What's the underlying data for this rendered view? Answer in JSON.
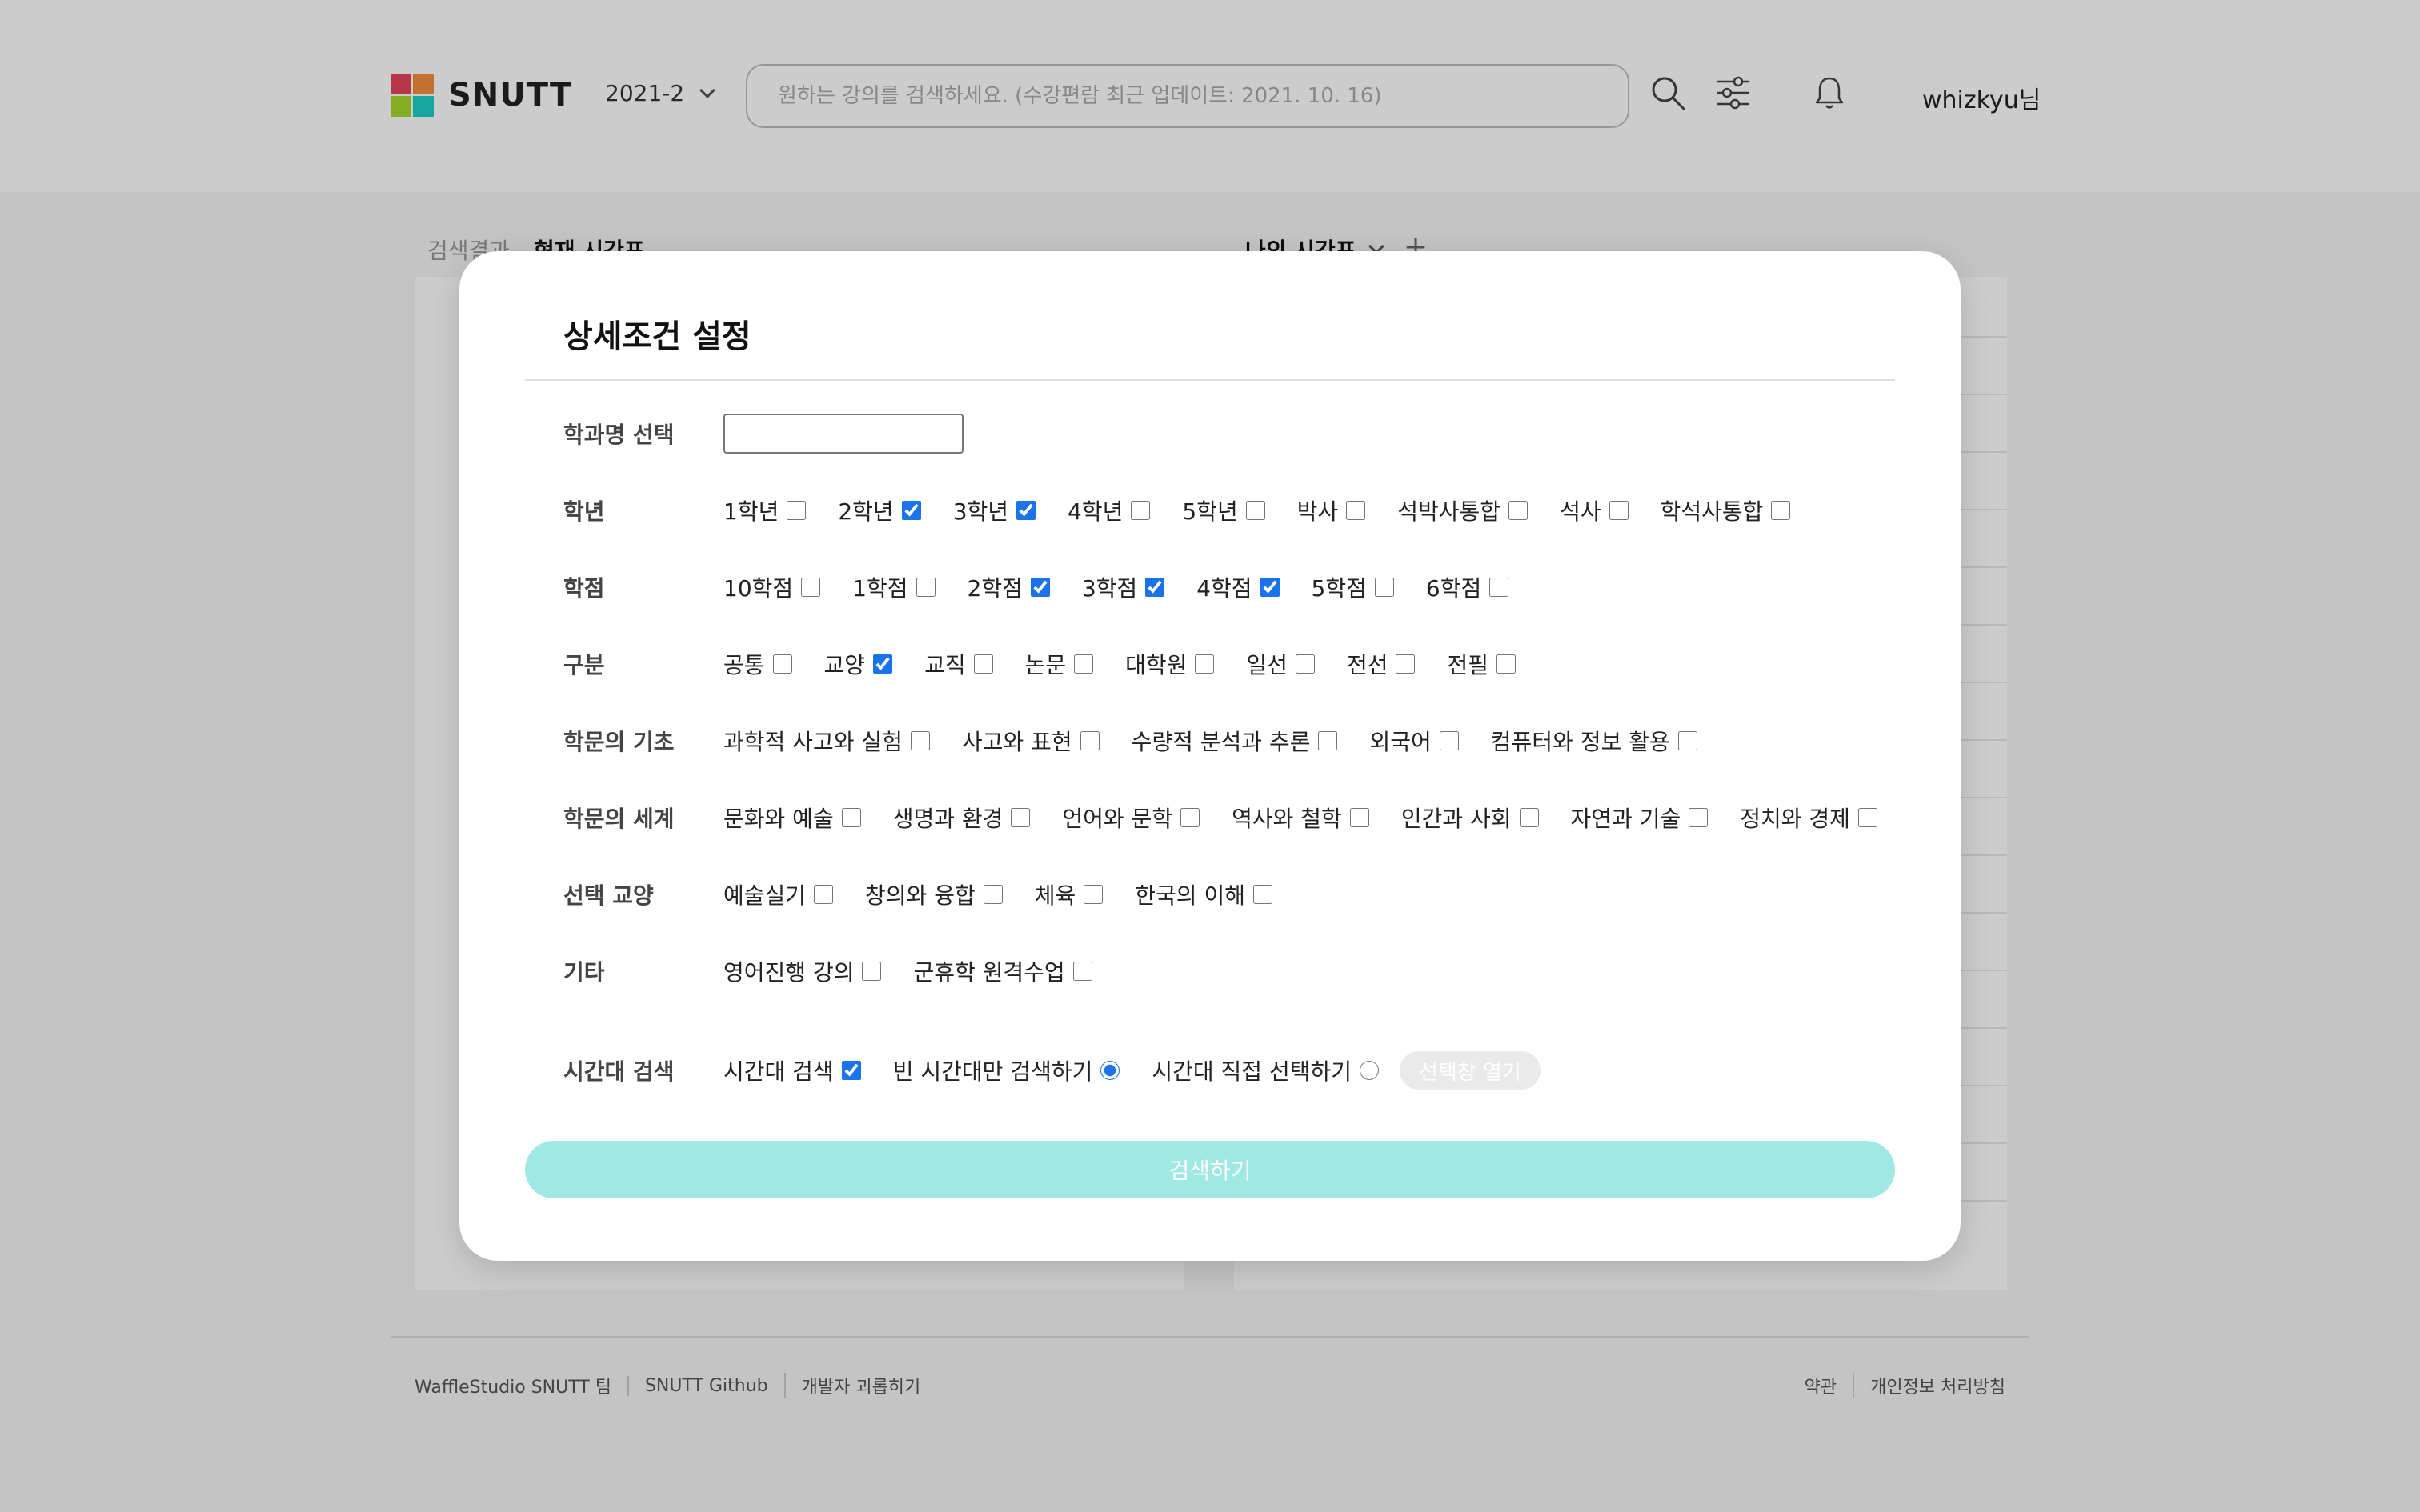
{
  "header": {
    "logo_text": "SNUTT",
    "semester": "2021-2",
    "search_placeholder": "원하는 강의를 검색하세요. (수강편람 최근 업데이트: 2021. 10. 16)",
    "username": "whizkyu님"
  },
  "background": {
    "tab_search": "검색결과",
    "tab_current": "현재 시간표",
    "my_timetable": "나의 시간표",
    "plus": "+"
  },
  "footer": {
    "left": [
      "WaffleStudio SNUTT 팀",
      "SNUTT Github",
      "개발자 괴롭히기"
    ],
    "right": [
      "약관",
      "개인정보 처리방침"
    ]
  },
  "modal": {
    "title": "상세조건 설정",
    "dept_label": "학과명 선택",
    "dept_value": "",
    "rows": [
      {
        "label": "학년",
        "options": [
          {
            "text": "1학년",
            "checked": false
          },
          {
            "text": "2학년",
            "checked": true
          },
          {
            "text": "3학년",
            "checked": true
          },
          {
            "text": "4학년",
            "checked": false
          },
          {
            "text": "5학년",
            "checked": false
          },
          {
            "text": "박사",
            "checked": false
          },
          {
            "text": "석박사통합",
            "checked": false
          },
          {
            "text": "석사",
            "checked": false
          },
          {
            "text": "학석사통합",
            "checked": false
          }
        ]
      },
      {
        "label": "학점",
        "options": [
          {
            "text": "10학점",
            "checked": false
          },
          {
            "text": "1학점",
            "checked": false
          },
          {
            "text": "2학점",
            "checked": true
          },
          {
            "text": "3학점",
            "checked": true
          },
          {
            "text": "4학점",
            "checked": true
          },
          {
            "text": "5학점",
            "checked": false
          },
          {
            "text": "6학점",
            "checked": false
          }
        ]
      },
      {
        "label": "구분",
        "options": [
          {
            "text": "공통",
            "checked": false
          },
          {
            "text": "교양",
            "checked": true
          },
          {
            "text": "교직",
            "checked": false
          },
          {
            "text": "논문",
            "checked": false
          },
          {
            "text": "대학원",
            "checked": false
          },
          {
            "text": "일선",
            "checked": false
          },
          {
            "text": "전선",
            "checked": false
          },
          {
            "text": "전필",
            "checked": false
          }
        ]
      },
      {
        "label": "학문의 기초",
        "options": [
          {
            "text": "과학적 사고와 실험",
            "checked": false
          },
          {
            "text": "사고와 표현",
            "checked": false
          },
          {
            "text": "수량적 분석과 추론",
            "checked": false
          },
          {
            "text": "외국어",
            "checked": false
          },
          {
            "text": "컴퓨터와 정보 활용",
            "checked": false
          }
        ]
      },
      {
        "label": "학문의 세계",
        "options": [
          {
            "text": "문화와 예술",
            "checked": false
          },
          {
            "text": "생명과 환경",
            "checked": false
          },
          {
            "text": "언어와 문학",
            "checked": false
          },
          {
            "text": "역사와 철학",
            "checked": false
          },
          {
            "text": "인간과 사회",
            "checked": false
          },
          {
            "text": "자연과 기술",
            "checked": false
          },
          {
            "text": "정치와 경제",
            "checked": false
          }
        ]
      },
      {
        "label": "선택 교양",
        "options": [
          {
            "text": "예술실기",
            "checked": false
          },
          {
            "text": "창의와 융합",
            "checked": false
          },
          {
            "text": "체육",
            "checked": false
          },
          {
            "text": "한국의 이해",
            "checked": false
          }
        ]
      },
      {
        "label": "기타",
        "options": [
          {
            "text": "영어진행 강의",
            "checked": false
          },
          {
            "text": "군휴학 원격수업",
            "checked": false
          }
        ]
      }
    ],
    "time": {
      "label": "시간대 검색",
      "checkbox_label": "시간대 검색",
      "checkbox_checked": true,
      "radio_empty_label": "빈 시간대만 검색하기",
      "radio_empty_checked": true,
      "radio_manual_label": "시간대 직접 선택하기",
      "radio_manual_checked": false,
      "open_button": "선택창 열기"
    },
    "submit": "검색하기"
  },
  "colors": {
    "accent_teal": "#a0e8e3",
    "checkbox_blue": "#1a73e8",
    "overlay": "rgba(0,0,0,0.2)"
  },
  "icons": [
    "search-icon",
    "filter-icon",
    "bell-icon",
    "chevron-down-icon"
  ]
}
